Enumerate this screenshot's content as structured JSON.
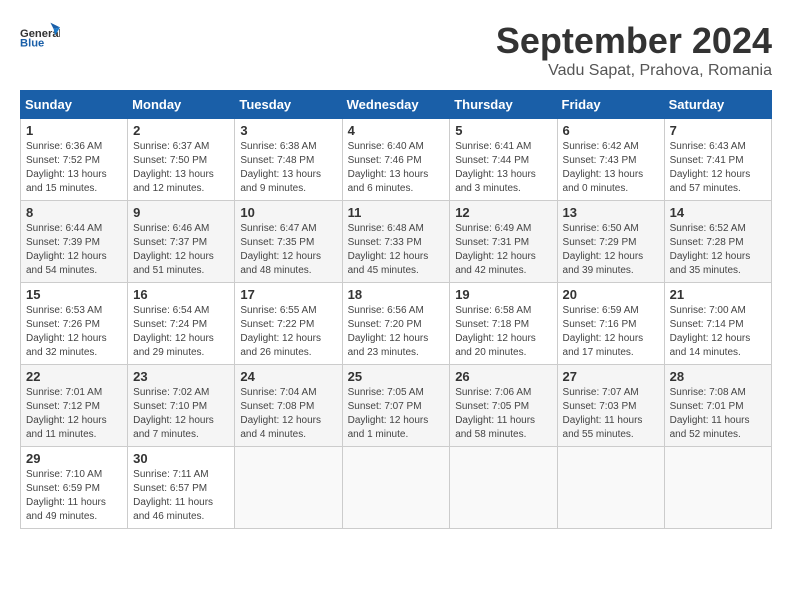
{
  "header": {
    "logo_general": "General",
    "logo_blue": "Blue",
    "title": "September 2024",
    "location": "Vadu Sapat, Prahova, Romania"
  },
  "weekdays": [
    "Sunday",
    "Monday",
    "Tuesday",
    "Wednesday",
    "Thursday",
    "Friday",
    "Saturday"
  ],
  "weeks": [
    [
      {
        "day": "1",
        "sunrise": "Sunrise: 6:36 AM",
        "sunset": "Sunset: 7:52 PM",
        "daylight": "Daylight: 13 hours and 15 minutes."
      },
      {
        "day": "2",
        "sunrise": "Sunrise: 6:37 AM",
        "sunset": "Sunset: 7:50 PM",
        "daylight": "Daylight: 13 hours and 12 minutes."
      },
      {
        "day": "3",
        "sunrise": "Sunrise: 6:38 AM",
        "sunset": "Sunset: 7:48 PM",
        "daylight": "Daylight: 13 hours and 9 minutes."
      },
      {
        "day": "4",
        "sunrise": "Sunrise: 6:40 AM",
        "sunset": "Sunset: 7:46 PM",
        "daylight": "Daylight: 13 hours and 6 minutes."
      },
      {
        "day": "5",
        "sunrise": "Sunrise: 6:41 AM",
        "sunset": "Sunset: 7:44 PM",
        "daylight": "Daylight: 13 hours and 3 minutes."
      },
      {
        "day": "6",
        "sunrise": "Sunrise: 6:42 AM",
        "sunset": "Sunset: 7:43 PM",
        "daylight": "Daylight: 13 hours and 0 minutes."
      },
      {
        "day": "7",
        "sunrise": "Sunrise: 6:43 AM",
        "sunset": "Sunset: 7:41 PM",
        "daylight": "Daylight: 12 hours and 57 minutes."
      }
    ],
    [
      {
        "day": "8",
        "sunrise": "Sunrise: 6:44 AM",
        "sunset": "Sunset: 7:39 PM",
        "daylight": "Daylight: 12 hours and 54 minutes."
      },
      {
        "day": "9",
        "sunrise": "Sunrise: 6:46 AM",
        "sunset": "Sunset: 7:37 PM",
        "daylight": "Daylight: 12 hours and 51 minutes."
      },
      {
        "day": "10",
        "sunrise": "Sunrise: 6:47 AM",
        "sunset": "Sunset: 7:35 PM",
        "daylight": "Daylight: 12 hours and 48 minutes."
      },
      {
        "day": "11",
        "sunrise": "Sunrise: 6:48 AM",
        "sunset": "Sunset: 7:33 PM",
        "daylight": "Daylight: 12 hours and 45 minutes."
      },
      {
        "day": "12",
        "sunrise": "Sunrise: 6:49 AM",
        "sunset": "Sunset: 7:31 PM",
        "daylight": "Daylight: 12 hours and 42 minutes."
      },
      {
        "day": "13",
        "sunrise": "Sunrise: 6:50 AM",
        "sunset": "Sunset: 7:29 PM",
        "daylight": "Daylight: 12 hours and 39 minutes."
      },
      {
        "day": "14",
        "sunrise": "Sunrise: 6:52 AM",
        "sunset": "Sunset: 7:28 PM",
        "daylight": "Daylight: 12 hours and 35 minutes."
      }
    ],
    [
      {
        "day": "15",
        "sunrise": "Sunrise: 6:53 AM",
        "sunset": "Sunset: 7:26 PM",
        "daylight": "Daylight: 12 hours and 32 minutes."
      },
      {
        "day": "16",
        "sunrise": "Sunrise: 6:54 AM",
        "sunset": "Sunset: 7:24 PM",
        "daylight": "Daylight: 12 hours and 29 minutes."
      },
      {
        "day": "17",
        "sunrise": "Sunrise: 6:55 AM",
        "sunset": "Sunset: 7:22 PM",
        "daylight": "Daylight: 12 hours and 26 minutes."
      },
      {
        "day": "18",
        "sunrise": "Sunrise: 6:56 AM",
        "sunset": "Sunset: 7:20 PM",
        "daylight": "Daylight: 12 hours and 23 minutes."
      },
      {
        "day": "19",
        "sunrise": "Sunrise: 6:58 AM",
        "sunset": "Sunset: 7:18 PM",
        "daylight": "Daylight: 12 hours and 20 minutes."
      },
      {
        "day": "20",
        "sunrise": "Sunrise: 6:59 AM",
        "sunset": "Sunset: 7:16 PM",
        "daylight": "Daylight: 12 hours and 17 minutes."
      },
      {
        "day": "21",
        "sunrise": "Sunrise: 7:00 AM",
        "sunset": "Sunset: 7:14 PM",
        "daylight": "Daylight: 12 hours and 14 minutes."
      }
    ],
    [
      {
        "day": "22",
        "sunrise": "Sunrise: 7:01 AM",
        "sunset": "Sunset: 7:12 PM",
        "daylight": "Daylight: 12 hours and 11 minutes."
      },
      {
        "day": "23",
        "sunrise": "Sunrise: 7:02 AM",
        "sunset": "Sunset: 7:10 PM",
        "daylight": "Daylight: 12 hours and 7 minutes."
      },
      {
        "day": "24",
        "sunrise": "Sunrise: 7:04 AM",
        "sunset": "Sunset: 7:08 PM",
        "daylight": "Daylight: 12 hours and 4 minutes."
      },
      {
        "day": "25",
        "sunrise": "Sunrise: 7:05 AM",
        "sunset": "Sunset: 7:07 PM",
        "daylight": "Daylight: 12 hours and 1 minute."
      },
      {
        "day": "26",
        "sunrise": "Sunrise: 7:06 AM",
        "sunset": "Sunset: 7:05 PM",
        "daylight": "Daylight: 11 hours and 58 minutes."
      },
      {
        "day": "27",
        "sunrise": "Sunrise: 7:07 AM",
        "sunset": "Sunset: 7:03 PM",
        "daylight": "Daylight: 11 hours and 55 minutes."
      },
      {
        "day": "28",
        "sunrise": "Sunrise: 7:08 AM",
        "sunset": "Sunset: 7:01 PM",
        "daylight": "Daylight: 11 hours and 52 minutes."
      }
    ],
    [
      {
        "day": "29",
        "sunrise": "Sunrise: 7:10 AM",
        "sunset": "Sunset: 6:59 PM",
        "daylight": "Daylight: 11 hours and 49 minutes."
      },
      {
        "day": "30",
        "sunrise": "Sunrise: 7:11 AM",
        "sunset": "Sunset: 6:57 PM",
        "daylight": "Daylight: 11 hours and 46 minutes."
      },
      null,
      null,
      null,
      null,
      null
    ]
  ]
}
